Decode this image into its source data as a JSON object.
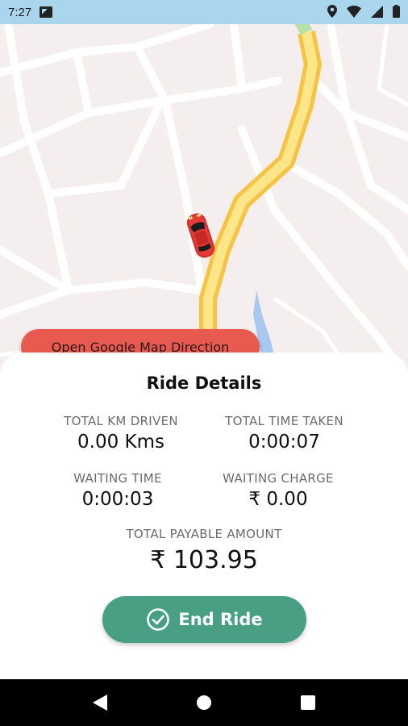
{
  "status_bar": {
    "time": "7:27",
    "icons": [
      "gallery-icon",
      "location-icon",
      "wifi-icon",
      "signal-icon",
      "battery-icon"
    ]
  },
  "map": {
    "route_color": "#fbd96a",
    "car_color": "#e53935",
    "direction_button_label": "Open Google Map Direction"
  },
  "ride_details": {
    "title": "Ride Details",
    "total_km": {
      "label": "TOTAL KM DRIVEN",
      "value": "0.00 Kms"
    },
    "total_time": {
      "label": "TOTAL TIME TAKEN",
      "value": "0:00:07"
    },
    "waiting_time": {
      "label": "WAITING TIME",
      "value": "0:00:03"
    },
    "waiting_charge": {
      "label": "WAITING CHARGE",
      "value": "₹ 0.00"
    },
    "total_payable": {
      "label": "TOTAL PAYABLE AMOUNT",
      "value": "₹ 103.95"
    },
    "end_ride_label": "End Ride"
  },
  "colors": {
    "accent_green": "#489f84",
    "accent_red": "#e8594f",
    "status_bar": "#a9d6ec"
  },
  "nav_bar": {
    "icons": [
      "back-icon",
      "home-icon",
      "recents-icon"
    ]
  }
}
